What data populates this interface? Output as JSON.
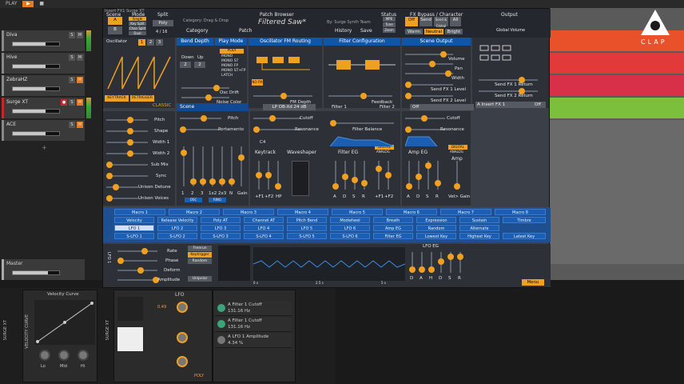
{
  "transport": {
    "play_label": "PLAY",
    "stop_label": "■"
  },
  "tracks": [
    {
      "name": "Diva",
      "color": "#9a9a9a",
      "rec": false
    },
    {
      "name": "Hive",
      "color": "#9a9a9a",
      "rec": false
    },
    {
      "name": "ZebraHZ",
      "color": "#9a9a9a",
      "rec": false
    },
    {
      "name": "Surge XT",
      "color": "#c62828",
      "rec": true
    },
    {
      "name": "ACE",
      "color": "#9a9a9a",
      "rec": false
    }
  ],
  "track_buttons": {
    "solo": "S",
    "mute": "M",
    "mute_on": "M"
  },
  "master": {
    "name": "Master"
  },
  "surge": {
    "window_title": "Insert FX1 Surge XT",
    "scene_label": "Scene",
    "scene_a": "A",
    "scene_b": "B",
    "mode_label": "Mode",
    "mode_options": [
      "Single",
      "Key Split",
      "Chan Split",
      "Dual"
    ],
    "split_label": "Split",
    "poly_label": "Poly",
    "poly_value": "4 / 16",
    "patch_browser_label": "Patch Browser",
    "category_line": "Category: Drag & Drop",
    "category_label": "Category",
    "patch_label": "Patch",
    "patch_name": "Filtered Saw*",
    "author_line": "By: Surge Synth Team",
    "history_label": "History",
    "save_label": "Save",
    "status_label": "Status",
    "status_mpe": "MPE",
    "status_tune": "Tune",
    "status_zoom": "Zoom",
    "fx_bypass_label": "FX Bypass / Character",
    "fx_bypass_options": [
      "Off",
      "Send",
      "Send & Global",
      "All"
    ],
    "character_options": [
      "Warm",
      "Neutral",
      "Bright"
    ],
    "output_label": "Output",
    "global_volume_label": "Global Volume",
    "oscillator_label": "Oscillator",
    "osc_numbers": [
      "1",
      "2",
      "3"
    ],
    "keytrack_label": "KEYTRACK",
    "retrigger_label": "RETRIGGER",
    "classic_label": "CLASSIC",
    "osc_params": [
      "Pitch",
      "Shape",
      "Width 1",
      "Width 2",
      "Sub Mix",
      "Sync",
      "Unison Detune",
      "Unison Voices"
    ],
    "bend_depth_label": "Bend Depth",
    "play_mode_label": "Play Mode",
    "down_label": "Down",
    "up_label": "Up",
    "bend_down": "2",
    "bend_up": "2",
    "play_modes": [
      "POLY",
      "MONO",
      "MONO ST",
      "MONO FP",
      "MONO ST+FP",
      "LATCH"
    ],
    "osc_drift_label": "Osc Drift",
    "noise_color_label": "Noise Color",
    "fm_routing_label": "Oscillator FM Routing",
    "fm_depth_label": "FM Depth",
    "filter_config_label": "Filter Configuration",
    "feedback_label": "Feedback",
    "scene_output_label": "Scene Output",
    "volume_label": "Volume",
    "pan_label": "Pan",
    "width_label": "Width",
    "send_fx1_level": "Send FX 1 Level",
    "send_fx2_level": "Send FX 2 Level",
    "mixer_labels": [
      "1",
      "2",
      "3",
      "1x2",
      "2x3",
      "N",
      "Gain"
    ],
    "mixer_tags": [
      "OSC",
      "RING"
    ],
    "pitch_label": "Pitch",
    "portamento_label": "Portamento",
    "filter_type": "LP OB-Xd 24 dB",
    "filter1_label": "Filter 1",
    "filter2_label": "Filter 2",
    "filter2_type": "Off",
    "cutoff_label": "Cutoff",
    "resonance_label": "Resonance",
    "filter_balance_label": "Filter Balance",
    "keytrack_section": "Keytrack",
    "keytrack_value": "C4",
    "waveshaper_label": "Waveshaper",
    "keytrack_sliders": [
      "+F1",
      "+F2",
      "HP"
    ],
    "filter_eg_label": "Filter EG",
    "amp_eg_label": "Amp EG",
    "amp_label": "Amp",
    "digital_label": "DIGITAL",
    "analog_label": "ANALOG",
    "adsr": [
      "A",
      "D",
      "S",
      "R"
    ],
    "feg_extra": [
      "+F1",
      "+F2"
    ],
    "amp_extra": "Vel> Gain",
    "macros": [
      "Macro 1",
      "Macro 2",
      "Macro 3",
      "Macro 4",
      "Macro 5",
      "Macro 6",
      "Macro 7",
      "Macro 8"
    ],
    "mod_sources_row1": [
      "Velocity",
      "Release Velocity",
      "Poly AT",
      "Channel AT",
      "Pitch Bend",
      "Modwheel",
      "Breath",
      "Expression",
      "Sustain",
      "Timbre"
    ],
    "mod_sources_row2": [
      "LFO 1",
      "LFO 2",
      "LFO 3",
      "LFO 4",
      "LFO 5",
      "LFO 6",
      "Amp EG",
      "Random",
      "Alternate"
    ],
    "mod_sources_row3": [
      "S-LFO 1",
      "S-LFO 2",
      "S-LFO 3",
      "S-LFO 4",
      "S-LFO 5",
      "S-LFO 6",
      "Filter EG",
      "Lowest Key",
      "Highest Key",
      "Latest Key"
    ],
    "lfo_vertical_label": "LFO 1",
    "lfo_params": [
      "Rate",
      "Phase",
      "Deform",
      "Amplitude"
    ],
    "lfo_modes": [
      "Freerun",
      "Keytrigger",
      "Random"
    ],
    "unipolar_label": "Unipolar",
    "lfo_eg_label": "LFO EG",
    "lfo_eg_labels": [
      "D",
      "A",
      "H",
      "D",
      "S",
      "R"
    ],
    "lfo_time_ticks": [
      "0 s",
      "2.5 s",
      "5 s"
    ],
    "menu_label": "Menu"
  },
  "fxpanel": {
    "send_fx1_return": "Send FX 1 Return",
    "send_fx2_return": "Send FX 2 Return",
    "insert_fx": "A Insert FX 1",
    "insert_fx_value": "Off"
  },
  "clap": {
    "logo_text": "CLAP"
  },
  "devices": {
    "surge_vertical": "SURGE XT",
    "velocity_curve_vertical": "VELOCITY CURVE",
    "velocity_curve_title": "Velocity Curve",
    "knob_labels": [
      "Lo",
      "Mid",
      "Hi"
    ],
    "surge_vertical2": "SURGE XT",
    "lfo_title": "LFO",
    "lfo_rate": "0.49",
    "poly_label": "POLY",
    "poly_value": "POLY",
    "mod_targets": [
      {
        "name": "A Filter 1 Cutoff",
        "value": "131.16 Hz"
      },
      {
        "name": "A Filter 1 Cutoff",
        "value": "131.16 Hz"
      },
      {
        "name": "A LFO 1 Amplitude",
        "value": "4.34 %"
      }
    ]
  },
  "colors": {
    "accent": "#f0a020",
    "blue": "#1a5fb4",
    "panel": "#2d3036"
  }
}
